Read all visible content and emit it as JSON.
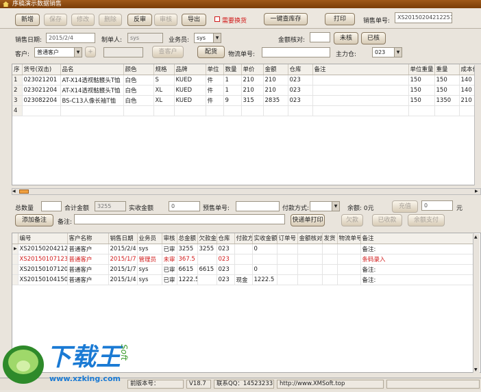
{
  "app": {
    "title": "序稿演示数据销售"
  },
  "toolbar": {
    "add": "新增",
    "save": "保存",
    "edit": "修改",
    "delete": "删除",
    "unaudit": "反审",
    "audit": "审核",
    "export": "导出",
    "need_swap_label": "需要换货",
    "view_stock": "一键查库存",
    "print": "打印",
    "order_no_label": "销售单号:",
    "order_no_value": "XS20150204212251"
  },
  "form": {
    "date_label": "销售日期:",
    "date_value": "2015/2/4",
    "maker_label": "制单人:",
    "maker_value": "sys",
    "salesman_label": "业务员:",
    "salesman_value": "sys",
    "amount_check_label": "金额核对:",
    "amount_check_value": "",
    "unchecked_btn": "未核",
    "checked_btn": "已核",
    "customer_label": "客户:",
    "customer_value": "普通客户",
    "plus_btn": "+",
    "customer_extra": "",
    "view_customer_btn": "查客户",
    "ship_btn": "配货",
    "logistics_label": "物流单号:",
    "logistics_value": "",
    "warehouse_label": "主力仓:",
    "warehouse_value": "023"
  },
  "detail_grid": {
    "columns": [
      "序",
      "货号(双击)",
      "品名",
      "颜色",
      "规格",
      "品牌",
      "单位",
      "数量",
      "单价",
      "金额",
      "仓库",
      "备注",
      "单位重量",
      "重量",
      "成本价"
    ],
    "rows": [
      [
        "1",
        "023021201",
        "AT-X14透视骷髅头T恤",
        "白色",
        "S",
        "KUED",
        "件",
        "1",
        "210",
        "210",
        "023",
        "",
        "150",
        "150",
        "140"
      ],
      [
        "2",
        "023021204",
        "AT-X14透视骷髅头T恤",
        "白色",
        "XL",
        "KUED",
        "件",
        "1",
        "210",
        "210",
        "023",
        "",
        "150",
        "150",
        "140"
      ],
      [
        "3",
        "023082204",
        "BS-C13人像长袖T恤",
        "白色",
        "XL",
        "KUED",
        "件",
        "9",
        "315",
        "2835",
        "023",
        "",
        "150",
        "1350",
        "210"
      ],
      [
        "4",
        "",
        "",
        "",
        "",
        "",
        "",
        "",
        "",
        "",
        "",
        "",
        "",
        "",
        ""
      ]
    ]
  },
  "summary": {
    "total_qty_label": "总数量",
    "total_qty_value": "",
    "total_amount_label": "合计金额",
    "total_amount_value": "3255",
    "received_label": "实收金额",
    "received_value": "0",
    "presale_label": "预售单号:",
    "presale_value": "",
    "payment_label": "付款方式:",
    "payment_value": "",
    "balance_label": "余额: 0元",
    "recharge_btn": "充值",
    "recharge_value": "0",
    "yuan": "元",
    "add_note_btn": "添加备注",
    "note_label": "备注:",
    "note_value": "",
    "express_print_btn": "快递单打印",
    "owe_btn": "欠款",
    "collected_btn": "已收款",
    "balance_pay_btn": "余额支付"
  },
  "order_grid": {
    "columns": [
      "编号",
      "客户名称",
      "销售日期",
      "业务员",
      "审核",
      "总金额",
      "欠款金",
      "仓库",
      "付款方",
      "实收金额",
      "订单号",
      "金额核对",
      "发货",
      "物流单号",
      "备注"
    ],
    "rows": [
      {
        "cells": [
          "XS20150204212251 2",
          "普通客户",
          "2015/2/4",
          "sys",
          "已审",
          "3255",
          "3255",
          "023",
          "",
          "0",
          "",
          "",
          "",
          "",
          "备注:"
        ],
        "red": false,
        "current": true
      },
      {
        "cells": [
          "XS20150107123639 2",
          "普通客户",
          "2015/1/7",
          "管理员",
          "未审",
          "367.5",
          "",
          "023",
          "",
          "",
          "",
          "",
          "",
          "",
          "条码录入"
        ],
        "red": true,
        "current": false
      },
      {
        "cells": [
          "XS20150107120002 2",
          "普通客户",
          "2015/1/7",
          "sys",
          "已审",
          "6615",
          "6615",
          "023",
          "",
          "0",
          "",
          "",
          "",
          "",
          "备注:"
        ],
        "red": false,
        "current": false
      },
      {
        "cells": [
          "XS20150104150203 2",
          "普通客户",
          "2015/1/4",
          "sys",
          "已审",
          "1222.5",
          "",
          "023",
          "现金",
          "1222.5",
          "",
          "",
          "",
          "",
          "备注:"
        ],
        "red": false,
        "current": false
      }
    ]
  },
  "statusbar": {
    "version_label": "前版本号：",
    "version_value": "V18.7",
    "qq": "联系QQ：14523233",
    "url": "http://www.XMSoft.top"
  },
  "watermark": {
    "brand": "下载王",
    "url": "www.xzking.com",
    "soft": "Soft"
  },
  "colors": {
    "accent": "#d01818",
    "titlebar": "#8a4a10"
  }
}
